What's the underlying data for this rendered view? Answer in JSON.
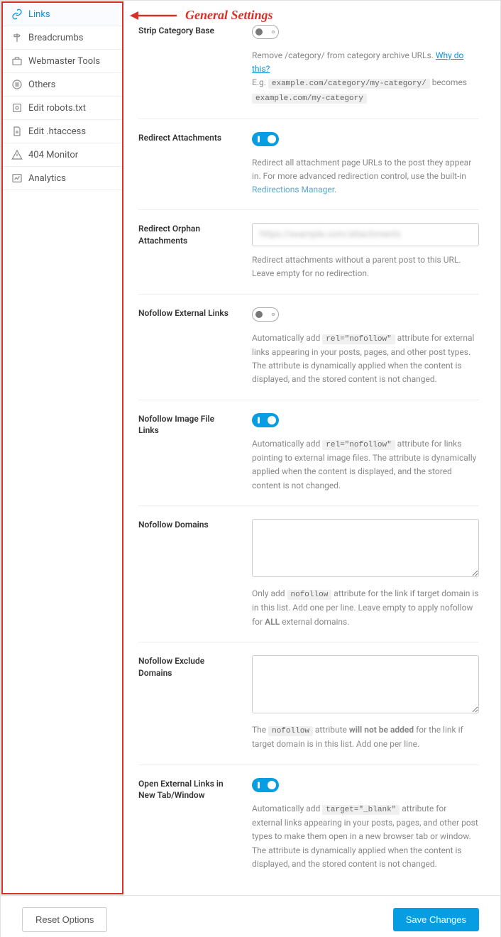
{
  "annotation": {
    "text": "General Settings"
  },
  "sidebar": {
    "items": [
      {
        "id": "links",
        "label": "Links",
        "active": true
      },
      {
        "id": "breadcrumbs",
        "label": "Breadcrumbs"
      },
      {
        "id": "webmaster-tools",
        "label": "Webmaster Tools"
      },
      {
        "id": "others",
        "label": "Others"
      },
      {
        "id": "edit-robots",
        "label": "Edit robots.txt"
      },
      {
        "id": "edit-htaccess",
        "label": "Edit .htaccess"
      },
      {
        "id": "404-monitor",
        "label": "404 Monitor"
      },
      {
        "id": "analytics",
        "label": "Analytics"
      }
    ]
  },
  "settings": {
    "strip_category_base": {
      "label": "Strip Category Base",
      "desc_pre": "Remove /category/ from category archive URLs. ",
      "link_text": "Why do this?",
      "desc_eg": "E.g. ",
      "code1": "example.com/category/my-category/",
      "desc_becomes": " becomes ",
      "code2": "example.com/my-category"
    },
    "redirect_attachments": {
      "label": "Redirect Attachments",
      "desc": "Redirect all attachment page URLs to the post they appear in. For more advanced redirection control, use the built-in ",
      "link_text": "Redirections Manager",
      "desc_after": "."
    },
    "redirect_orphan": {
      "label": "Redirect Orphan Attachments",
      "placeholder_blur": "https://example.com/attachments",
      "desc": "Redirect attachments without a parent post to this URL. Leave empty for no redirection."
    },
    "nofollow_external": {
      "label": "Nofollow External Links",
      "desc_pre": "Automatically add ",
      "code": "rel=\"nofollow\"",
      "desc_post": " attribute for external links appearing in your posts, pages, and other post types. The attribute is dynamically applied when the content is displayed, and the stored content is not changed."
    },
    "nofollow_image": {
      "label": "Nofollow Image File Links",
      "desc_pre": "Automatically add ",
      "code": "rel=\"nofollow\"",
      "desc_post": " attribute for links pointing to external image files. The attribute is dynamically applied when the content is displayed, and the stored content is not changed."
    },
    "nofollow_domains": {
      "label": "Nofollow Domains",
      "desc_pre": "Only add ",
      "code": "nofollow",
      "desc_mid": " attribute for the link if target domain is in this list. Add one per line. Leave empty to apply nofollow for ",
      "bold": "ALL",
      "desc_post": " external domains."
    },
    "nofollow_exclude": {
      "label": "Nofollow Exclude Domains",
      "desc_pre": "The ",
      "code": "nofollow",
      "desc_mid": " attribute ",
      "bold": "will not be added",
      "desc_post": " for the link if target domain is in this list. Add one per line."
    },
    "open_external": {
      "label": "Open External Links in New Tab/Window",
      "desc_pre": "Automatically add ",
      "code": "target=\"_blank\"",
      "desc_post": " attribute for external links appearing in your posts, pages, and other post types to make them open in a new browser tab or window. The attribute is dynamically applied when the content is displayed, and the stored content is not changed."
    }
  },
  "footer": {
    "reset": "Reset Options",
    "save": "Save Changes"
  }
}
